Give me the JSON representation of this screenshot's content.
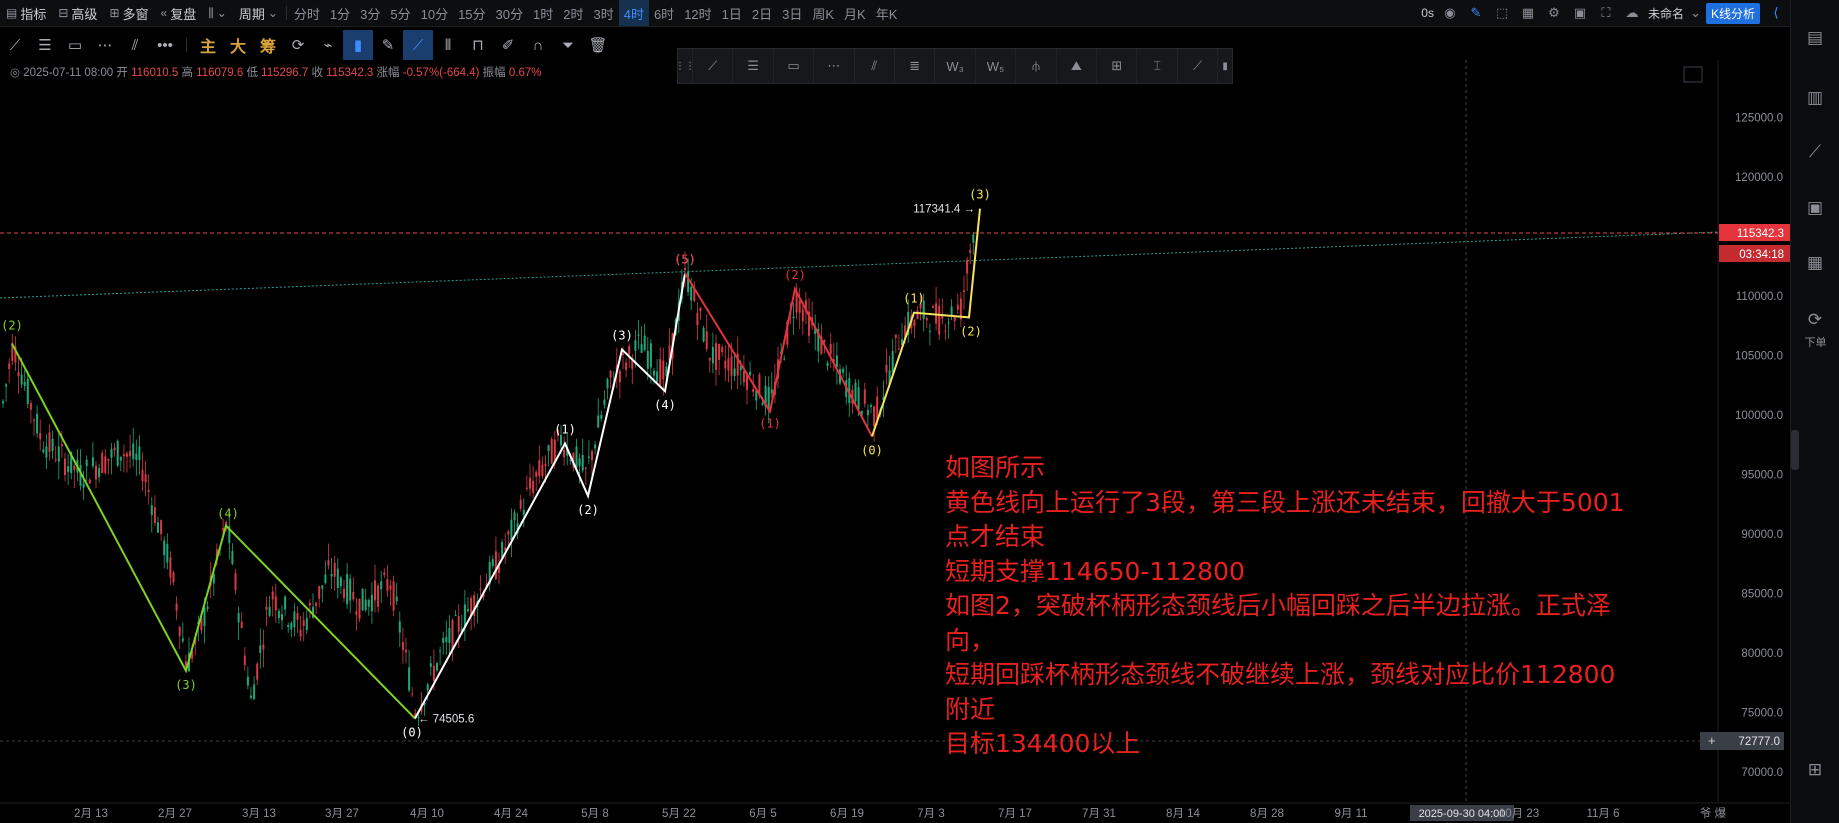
{
  "topbar": {
    "items": [
      {
        "label": "指标",
        "icon": "indicator-icon"
      },
      {
        "label": "高级",
        "icon": "advanced-icon"
      },
      {
        "label": "多窗",
        "icon": "multi-window-icon"
      },
      {
        "label": "复盘",
        "icon": "replay-icon"
      },
      {
        "label": "",
        "icon": "chart-type-icon"
      },
      {
        "label": "周期",
        "icon": "period-icon"
      }
    ],
    "periods": [
      "分时",
      "1分",
      "3分",
      "5分",
      "10分",
      "15分",
      "30分",
      "1时",
      "2时",
      "3时",
      "4时",
      "6时",
      "12时",
      "1日",
      "2日",
      "3日",
      "周K",
      "月K",
      "年K"
    ],
    "active_period": "4时",
    "right": {
      "countdown": "0s",
      "name": "未命名",
      "kline_btn": "K线分析"
    }
  },
  "toolbar2": {
    "tools": [
      "line-tool-icon",
      "horizontal-line-icon",
      "rectangle-icon",
      "channel-icon",
      "parallel-icon",
      "more-icon"
    ],
    "main_labels": [
      "主",
      "大",
      "筹"
    ],
    "tools2": [
      "refresh-icon",
      "brush-icon",
      "bookmark-icon",
      "pen-icon",
      "draw-icon",
      "candle-icon",
      "lock-icon",
      "edit-icon",
      "magnet-icon",
      "filter-icon",
      "trash-icon"
    ]
  },
  "drawbar": [
    "ray-icon",
    "hline-icon",
    "rect-icon",
    "dots-icon",
    "parallel-icon",
    "grid-icon",
    "wave3-icon",
    "wave5-icon",
    "triangle-icon",
    "pattern-icon",
    "measure-icon",
    "text-icon",
    "brush-icon"
  ],
  "ohlc": {
    "date": "2025-07-11 08:00",
    "open_label": "开",
    "open": "116010.5",
    "high_label": "高",
    "high": "116079.6",
    "low_label": "低",
    "low": "115296.7",
    "close_label": "收",
    "close": "115342.3",
    "chg_label": "涨幅",
    "chg": "-0.57%(-664.4)",
    "amp_label": "振幅",
    "amp": "0.67%"
  },
  "chart_data": {
    "type": "line",
    "y_ticks": [
      125000.0,
      120000.0,
      115000.0,
      110000.0,
      105000.0,
      100000.0,
      95000.0,
      90000.0,
      85000.0,
      80000.0,
      75000.0,
      70000.0
    ],
    "ylim": [
      68000,
      128500
    ],
    "x_tick_labels": [
      "2月 13",
      "2月 27",
      "3月 13",
      "3月 27",
      "4月 10",
      "4月 24",
      "5月 8",
      "5月 22",
      "6月 5",
      "6月 19",
      "7月 3",
      "7月 17",
      "7月 31",
      "8月 14",
      "8月 28",
      "9月 11",
      "2025-09-30 04:00",
      "10月 23",
      "11月 6",
      "爷 爆"
    ],
    "price_label": "115342.3",
    "countdown": "03:34:18",
    "cursor_price": "72777.0",
    "high_marker": "117341.4 →",
    "low_marker": "← 74505.6",
    "series": [
      {
        "color": "#7ed321",
        "points": [
          [
            "2(2)",
            106000
          ],
          [
            "(3)",
            78500
          ],
          [
            "(4)",
            90700
          ],
          [
            "(0)",
            74500
          ]
        ],
        "labels": [
          {
            "t": "(2)",
            "x": "2025-01-30",
            "y": 106000
          },
          {
            "t": "(3)",
            "x": "2025-03-02",
            "y": 78500
          },
          {
            "t": "(4)",
            "x": "2025-03-09",
            "y": 90700
          }
        ]
      },
      {
        "color": "#ffffff",
        "points": [],
        "labels": [
          {
            "t": "(0)",
            "y": 74500
          },
          {
            "t": "(1)",
            "y": 97600
          },
          {
            "t": "(2)",
            "y": 93200
          },
          {
            "t": "(3)",
            "y": 105500
          },
          {
            "t": "(4)",
            "y": 102000
          },
          {
            "t": "(5)",
            "y": 111900
          }
        ]
      },
      {
        "color": "#e5343b",
        "points": [],
        "labels": [
          {
            "t": "(5)",
            "y": 111900
          },
          {
            "t": "(1)",
            "y": 100300
          },
          {
            "t": "(2)",
            "y": 110600
          },
          {
            "t": "(0)",
            "y": 98200
          }
        ]
      },
      {
        "color": "#f6e35c",
        "points": [],
        "labels": [
          {
            "t": "(0)",
            "y": 98200
          },
          {
            "t": "(1)",
            "y": 108600
          },
          {
            "t": "(2)",
            "y": 108200
          },
          {
            "t": "(3)",
            "y": 117341.4
          }
        ]
      }
    ],
    "wave_points": {
      "green": [
        [
          0,
          106000
        ],
        [
          1,
          78500
        ],
        [
          2,
          90700
        ],
        [
          3,
          74500
        ]
      ],
      "white": [
        [
          0,
          74500
        ],
        [
          1,
          97600
        ],
        [
          2,
          93200
        ],
        [
          3,
          105500
        ],
        [
          4,
          102000
        ],
        [
          5,
          111900
        ]
      ],
      "red": [
        [
          0,
          111900
        ],
        [
          1,
          100300
        ],
        [
          2,
          110600
        ],
        [
          3,
          98200
        ]
      ],
      "yellow": [
        [
          0,
          98200
        ],
        [
          1,
          108600
        ],
        [
          2,
          108200
        ],
        [
          3,
          117341.4
        ]
      ]
    }
  },
  "annotation": {
    "lines": [
      "如图所示",
      "黄色线向上运行了3段，第三段上涨还未结束，回撤大于5001",
      "点才结束",
      "短期支撑114650-112800",
      "如图2，突破杯柄形态颈线后小幅回踩之后半边拉涨。正式泽",
      "向，",
      "短期回踩杯柄形态颈线不破继续上涨，颈线对应比价112800",
      "附近",
      "目标134400以上"
    ]
  },
  "rightpanel": {
    "order_label": "下单"
  }
}
